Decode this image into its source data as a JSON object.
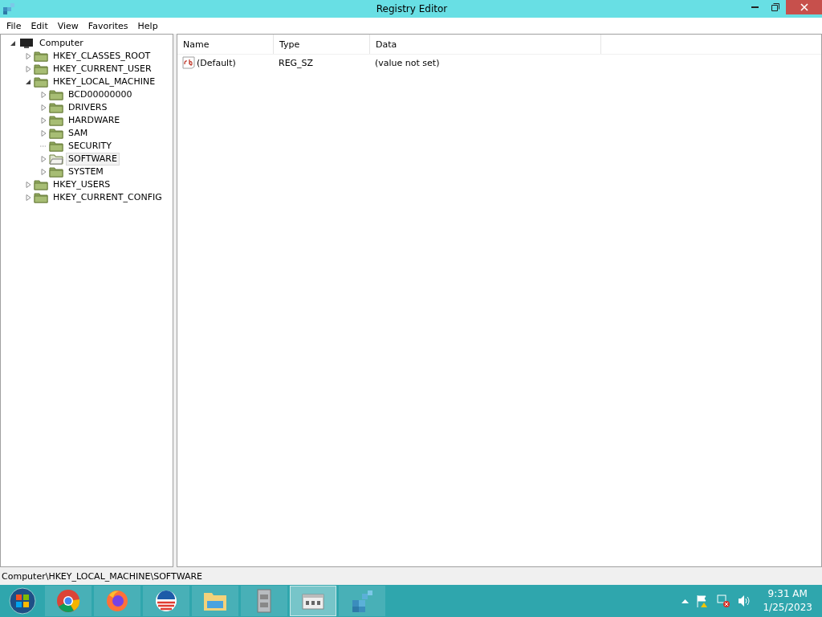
{
  "window": {
    "title": "Registry Editor"
  },
  "menu": [
    "File",
    "Edit",
    "View",
    "Favorites",
    "Help"
  ],
  "tree": {
    "label": "Computer",
    "expanded": true,
    "expandable": true,
    "selected": false,
    "children": [
      {
        "label": "HKEY_CLASSES_ROOT",
        "expandable": true,
        "selected": false
      },
      {
        "label": "HKEY_CURRENT_USER",
        "expandable": true,
        "selected": false
      },
      {
        "label": "HKEY_LOCAL_MACHINE",
        "expanded": true,
        "expandable": true,
        "selected": false,
        "children": [
          {
            "label": "BCD00000000",
            "expandable": true,
            "selected": false
          },
          {
            "label": "DRIVERS",
            "expandable": true,
            "selected": false
          },
          {
            "label": "HARDWARE",
            "expandable": true,
            "selected": false
          },
          {
            "label": "SAM",
            "expandable": true,
            "selected": false
          },
          {
            "label": "SECURITY",
            "expandable": false,
            "selected": false
          },
          {
            "label": "SOFTWARE",
            "expandable": true,
            "selected": true
          },
          {
            "label": "SYSTEM",
            "expandable": true,
            "selected": false
          }
        ]
      },
      {
        "label": "HKEY_USERS",
        "expandable": true,
        "selected": false
      },
      {
        "label": "HKEY_CURRENT_CONFIG",
        "expandable": true,
        "selected": false
      }
    ]
  },
  "table": {
    "columns": [
      "Name",
      "Type",
      "Data"
    ],
    "rows": [
      {
        "name": "(Default)",
        "type": "REG_SZ",
        "data": "(value not set)"
      }
    ]
  },
  "status_bar": "Computer\\HKEY_LOCAL_MACHINE\\SOFTWARE",
  "taskbar": {
    "items": [
      {
        "kind": "chrome",
        "selected": false
      },
      {
        "kind": "firefox",
        "selected": false
      },
      {
        "kind": "logo",
        "selected": false
      },
      {
        "kind": "explorer",
        "selected": false
      },
      {
        "kind": "cabinet",
        "selected": false
      },
      {
        "kind": "window",
        "selected": true
      },
      {
        "kind": "cubes",
        "selected": false
      }
    ],
    "time": "9:31 AM",
    "date": "1/25/2023"
  }
}
